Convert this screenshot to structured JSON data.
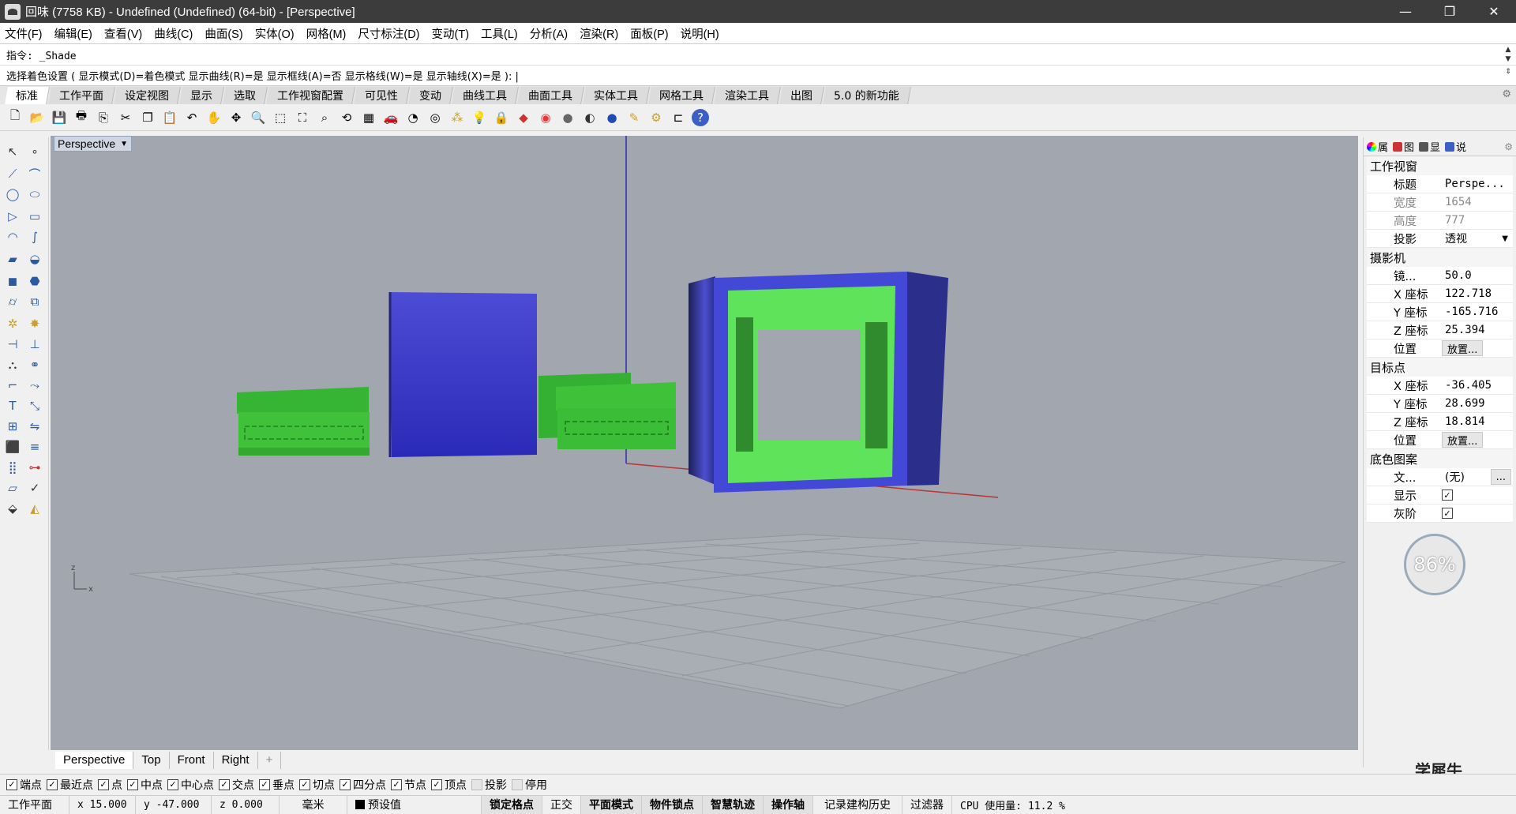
{
  "window": {
    "title": "回味 (7758 KB) - Undefined (Undefined) (64-bit) - [Perspective]",
    "minimize": "—",
    "maximize": "❐",
    "close": "✕"
  },
  "menus": [
    "文件(F)",
    "编辑(E)",
    "查看(V)",
    "曲线(C)",
    "曲面(S)",
    "实体(O)",
    "网格(M)",
    "尺寸标注(D)",
    "变动(T)",
    "工具(L)",
    "分析(A)",
    "渲染(R)",
    "面板(P)",
    "说明(H)"
  ],
  "command": {
    "history": "指令: _Shade",
    "prompt": "选择着色设置 ( 显示模式(D)=着色模式  显示曲线(R)=是  显示框线(A)=否  显示格线(W)=是  显示轴线(X)=是 ): |"
  },
  "toolbar_tabs": [
    "标准",
    "工作平面",
    "设定视图",
    "显示",
    "选取",
    "工作视窗配置",
    "可见性",
    "变动",
    "曲线工具",
    "曲面工具",
    "实体工具",
    "网格工具",
    "渲染工具",
    "出图",
    "5.0 的新功能"
  ],
  "viewport": {
    "title": "Perspective",
    "axis_z": "z",
    "axis_x": "x"
  },
  "viewport_tabs": [
    "Perspective",
    "Top",
    "Front",
    "Right",
    "+"
  ],
  "properties": {
    "tabs": [
      "属",
      "图",
      "显",
      "说"
    ],
    "viewport_section": "工作视窗",
    "title_label": "标题",
    "title_value": "Perspe...",
    "width_label": "宽度",
    "width_value": "1654",
    "height_label": "高度",
    "height_value": "777",
    "proj_label": "投影",
    "proj_value": "透视",
    "camera_section": "摄影机",
    "lens_label": "镜...",
    "lens_value": "50.0",
    "cx_label": "X 座标",
    "cx_value": "122.718",
    "cy_label": "Y 座标",
    "cy_value": "-165.716",
    "cz_label": "Z 座标",
    "cz_value": "25.394",
    "cpos_label": "位置",
    "cpos_btn": "放置...",
    "target_section": "目标点",
    "tx_label": "X 座标",
    "tx_value": "-36.405",
    "ty_label": "Y 座标",
    "ty_value": "28.699",
    "tz_label": "Z 座标",
    "tz_value": "18.814",
    "tpos_label": "位置",
    "tpos_btn": "放置...",
    "wall_section": "底色图案",
    "file_label": "文...",
    "file_value": "(无)",
    "file_btn": "...",
    "show_label": "显示",
    "gray_label": "灰阶"
  },
  "cpu_badge": "86%",
  "snaps": [
    {
      "label": "端点",
      "checked": true
    },
    {
      "label": "最近点",
      "checked": true
    },
    {
      "label": "点",
      "checked": true
    },
    {
      "label": "中点",
      "checked": true
    },
    {
      "label": "中心点",
      "checked": true
    },
    {
      "label": "交点",
      "checked": true
    },
    {
      "label": "垂点",
      "checked": true
    },
    {
      "label": "切点",
      "checked": true
    },
    {
      "label": "四分点",
      "checked": true
    },
    {
      "label": "节点",
      "checked": true
    },
    {
      "label": "顶点",
      "checked": true
    },
    {
      "label": "投影",
      "checked": false
    },
    {
      "label": "停用",
      "checked": false
    }
  ],
  "status": {
    "cplane": "工作平面",
    "x": "x 15.000",
    "y": "y -47.000",
    "z": "z 0.000",
    "unit": "毫米",
    "layer": "预设值",
    "grid_snap": "锁定格点",
    "ortho": "正交",
    "planar": "平面模式",
    "osnap": "物件锁点",
    "smarttrack": "智慧轨迹",
    "gumball": "操作轴",
    "history": "记录建构历史",
    "filter": "过滤器",
    "cpu": "CPU 使用量: 11.2 %"
  },
  "watermark": "学犀牛",
  "colors": {
    "viewport_bg": "#a2a7af",
    "green": "#3fc23a",
    "blue": "#3b3fd2",
    "dark_blue": "#26286a"
  }
}
